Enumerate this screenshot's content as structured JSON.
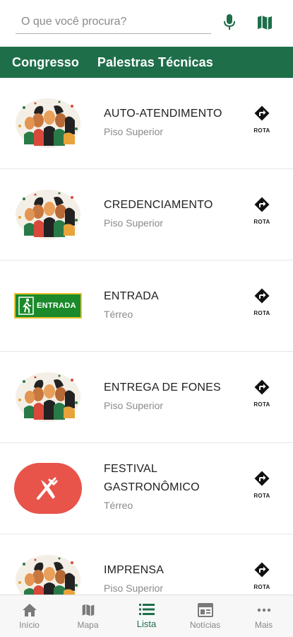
{
  "search": {
    "placeholder": "O que você procura?"
  },
  "icons": {
    "mic": "microphone-icon",
    "map": "map-icon"
  },
  "colors": {
    "brand": "#1e6e4a",
    "accent_red": "#e8544a",
    "entrance_green": "#1a8a2a"
  },
  "tabs": [
    {
      "label": "Congresso"
    },
    {
      "label": "Palestras Técnicas"
    }
  ],
  "route_label": "ROTA",
  "items": [
    {
      "title": "AUTO-ATENDIMENTO",
      "subtitle": "Piso Superior",
      "thumb": "people-illustration"
    },
    {
      "title": "CREDENCIAMENTO",
      "subtitle": "Piso Superior",
      "thumb": "people-illustration"
    },
    {
      "title": "ENTRADA",
      "subtitle": "Térreo",
      "thumb": "entrance-sign",
      "thumb_text": "ENTRADA"
    },
    {
      "title": "ENTREGA DE FONES",
      "subtitle": "Piso Superior",
      "thumb": "people-illustration"
    },
    {
      "title_line1": "FESTIVAL",
      "title_line2": "GASTRONÔMICO",
      "subtitle": "Térreo",
      "thumb": "fork-knife-icon"
    },
    {
      "title": "IMPRENSA",
      "subtitle": "Piso Superior",
      "thumb": "people-illustration"
    }
  ],
  "bottom_nav": [
    {
      "label": "Início",
      "icon": "home-icon"
    },
    {
      "label": "Mapa",
      "icon": "map-icon"
    },
    {
      "label": "Lista",
      "icon": "list-icon",
      "active": true
    },
    {
      "label": "Notícias",
      "icon": "news-icon"
    },
    {
      "label": "Mais",
      "icon": "more-icon"
    }
  ]
}
